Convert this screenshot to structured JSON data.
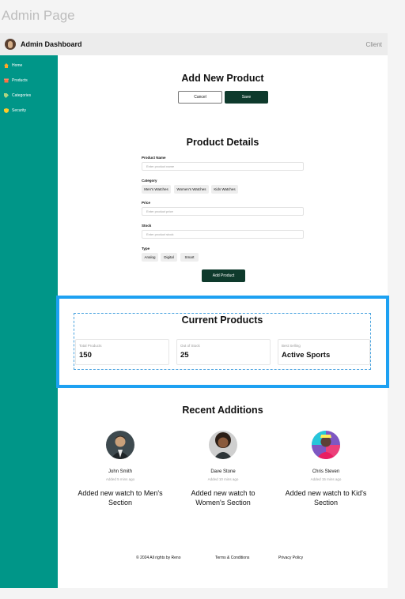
{
  "page_label": "Admin Page",
  "header": {
    "title": "Admin Dashboard",
    "user_label": "Client"
  },
  "sidebar": {
    "items": [
      {
        "label": "Home",
        "icon": "home-icon",
        "color": "#ffa726"
      },
      {
        "label": "Products",
        "icon": "box-icon",
        "color": "#ff7043"
      },
      {
        "label": "Categories",
        "icon": "tag-icon",
        "color": "#aed581"
      },
      {
        "label": "Security",
        "icon": "shield-icon",
        "color": "#ffca28"
      }
    ],
    "accent": "#009688"
  },
  "add_product": {
    "title": "Add New Product",
    "cancel_label": "Cancel",
    "save_label": "Save"
  },
  "details": {
    "title": "Product Details",
    "name_label": "Product Name",
    "name_placeholder": "Enter product name",
    "category_label": "Category",
    "categories": [
      "Men's Watches",
      "Women's Watches",
      "Kids Watches"
    ],
    "price_label": "Price",
    "price_placeholder": "Enter product price",
    "stock_label": "Stock",
    "stock_placeholder": "Enter product stock",
    "type_label": "Type",
    "types": [
      "Analog",
      "Digital",
      "Smart"
    ],
    "submit_label": "Add Product"
  },
  "current": {
    "title": "Current Products",
    "stats": [
      {
        "label": "Total Products",
        "value": "150"
      },
      {
        "label": "Out of Stock",
        "value": "25"
      },
      {
        "label": "Best Selling",
        "value": "Active Sports"
      }
    ]
  },
  "recent": {
    "title": "Recent Additions",
    "items": [
      {
        "name": "John Smith",
        "time": "Added 5 mins ago",
        "desc": "Added new watch to Men's Section"
      },
      {
        "name": "Dave Stone",
        "time": "Added 10 mins ago",
        "desc": "Added new watch to Women's Section"
      },
      {
        "name": "Chris Steven",
        "time": "Added 15 mins ago",
        "desc": "Added new watch to Kid's Section"
      }
    ]
  },
  "footer": {
    "copyright": "© 2024 All rights by Reno",
    "terms": "Terms & Conditions",
    "privacy": "Privacy Policy"
  },
  "colors": {
    "primary_dark": "#0e3a2c",
    "selection": "#1da1f2"
  }
}
